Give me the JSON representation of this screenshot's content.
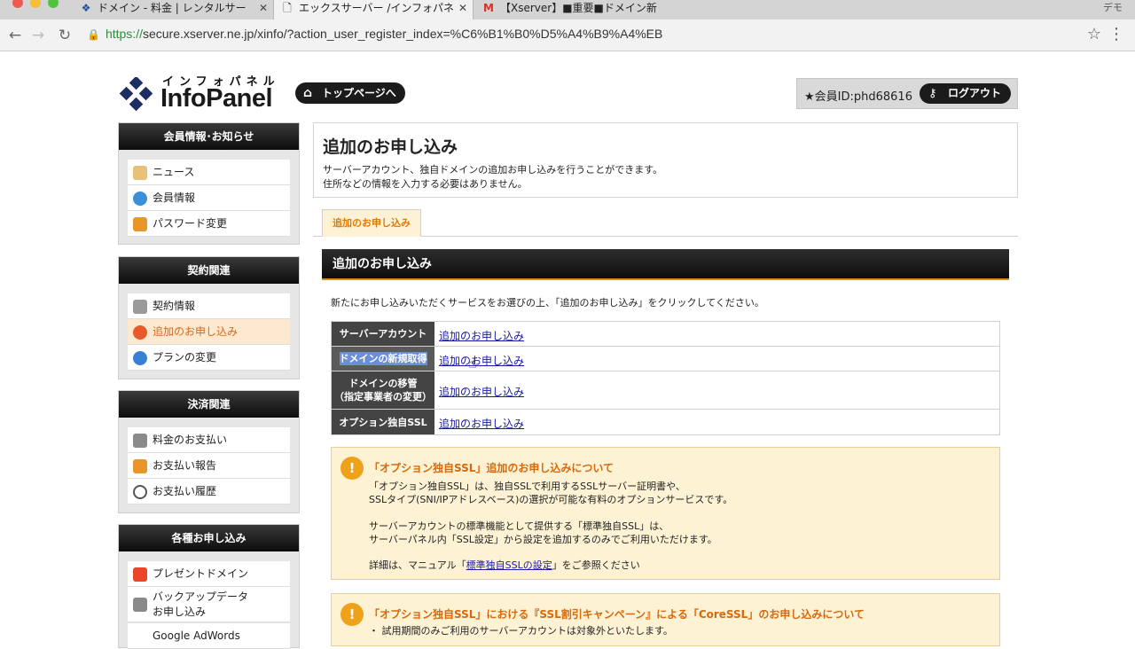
{
  "browser": {
    "tabs": [
      {
        "title": "ドメイン - 料金 | レンタルサー",
        "icon": "xserver-icon"
      },
      {
        "title": "エックスサーバー /インフォパネ",
        "icon": "doc-icon"
      },
      {
        "title": "【Xserver】■重要■ドメイン新",
        "icon": "gmail-icon"
      }
    ],
    "profile_label": "デモ",
    "url_secure": "https://",
    "url_rest": "secure.xserver.ne.jp/xinfo/?action_user_register_index=%C6%B1%B0%D5%A4%B9%A4%EB"
  },
  "header": {
    "logo_kana": "インフォパネル",
    "logo_brand": "InfoPanel",
    "top_button": "トップページへ",
    "member_id": "★会員ID:phd68616",
    "logout_button": "ログアウト"
  },
  "sidebar": {
    "sections": [
      {
        "title": "会員情報･お知らせ",
        "items": [
          "ニュース",
          "会員情報",
          "パスワード変更"
        ]
      },
      {
        "title": "契約関連",
        "items": [
          "契約情報",
          "追加のお申し込み",
          "プランの変更"
        ]
      },
      {
        "title": "決済関連",
        "items": [
          "料金のお支払い",
          "お支払い報告",
          "お支払い履歴"
        ]
      },
      {
        "title": "各種お申し込み",
        "items": [
          "プレゼントドメイン",
          "バックアップデータ",
          "お申し込み",
          "Google AdWords"
        ]
      }
    ]
  },
  "main": {
    "title": "追加のお申し込み",
    "desc_line1": "サーバーアカウント、独自ドメインの追加お申し込みを行うことができます。",
    "desc_line2": "住所などの情報を入力する必要はありません。",
    "tab_label": "追加のお申し込み",
    "section_title": "追加のお申し込み",
    "instruction": "新たにお申し込みいただくサービスをお選びの上、「追加のお申し込み」をクリックしてください。",
    "services": [
      {
        "label": "サーバーアカウント",
        "link": "追加のお申し込み"
      },
      {
        "label": "ドメインの新規取得",
        "link": "追加のお申し込み"
      },
      {
        "label1": "ドメインの移管",
        "label2": "（指定事業者の変更）",
        "link": "追加のお申し込み"
      },
      {
        "label": "オプション独自SSL",
        "link": "追加のお申し込み"
      }
    ],
    "note1": {
      "title": "「オプション独自SSL」追加のお申し込みについて",
      "l1": "「オプション独自SSL」は、独自SSLで利用するSSLサーバー証明書や、",
      "l2": "SSLタイプ(SNI/IPアドレスベース)の選択が可能な有料のオプションサービスです。",
      "l3": "サーバーアカウントの標準機能として提供する「標準独自SSL」は、",
      "l4": "サーバーパネル内「SSL設定」から設定を追加するのみでご利用いただけます。",
      "l5_pre": "詳細は、マニュアル「",
      "l5_link": "標準独自SSLの設定",
      "l5_post": "」をご参照ください"
    },
    "note2": {
      "title": "「オプション独自SSL」における『SSL割引キャンペーン』による「CoreSSL」のお申し込みについて",
      "l1": "・ 試用期間のみご利用のサーバーアカウントは対象外といたします。"
    }
  }
}
